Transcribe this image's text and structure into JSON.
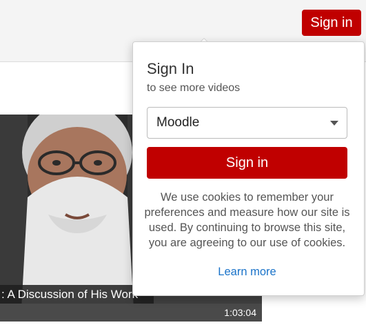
{
  "header": {
    "signin_label": "Sign in"
  },
  "video": {
    "title_fragment": ": A Discussion of His Work",
    "duration": "1:03:04"
  },
  "popover": {
    "title": "Sign In",
    "subtitle": "to see more videos",
    "provider_selected": "Moodle",
    "signin_button": "Sign in",
    "cookie_text": "We use cookies to remember your preferences and measure how our site is used. By continuing to browse this site, you are agreeing to our use of cookies.",
    "learn_more": "Learn more"
  },
  "colors": {
    "brand_red": "#c00000",
    "link_blue": "#1a73c9"
  }
}
